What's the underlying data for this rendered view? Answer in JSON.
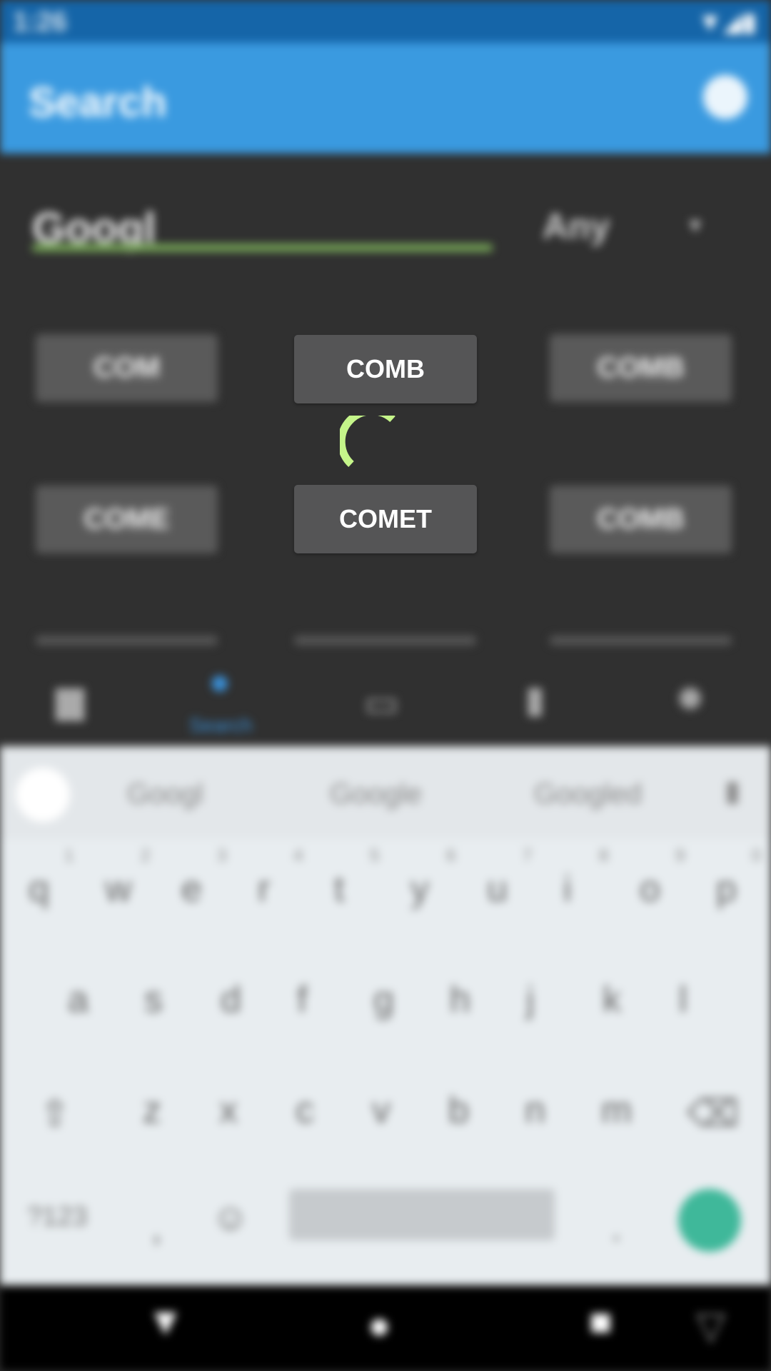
{
  "status_bar": {
    "time": "1:26"
  },
  "app_bar": {
    "title": "Search"
  },
  "search": {
    "query": "Googl",
    "type_label": "Any"
  },
  "results_blurred": [
    [
      "COM",
      "COMB",
      "COMB"
    ],
    [
      "COME",
      "COMET",
      "COMB"
    ]
  ],
  "overlay": {
    "button_1": "COMB",
    "button_2": "COMET",
    "spinner_color": "#c5f58a"
  },
  "bottom_nav": {
    "active_label": "Search"
  },
  "keyboard": {
    "suggestions": [
      "Googl",
      "Google",
      "Googled"
    ],
    "row1": [
      "q",
      "w",
      "e",
      "r",
      "t",
      "y",
      "u",
      "i",
      "o",
      "p"
    ],
    "row1_hints": [
      "1",
      "2",
      "3",
      "4",
      "5",
      "6",
      "7",
      "8",
      "9",
      "0"
    ],
    "row2": [
      "a",
      "s",
      "d",
      "f",
      "g",
      "h",
      "j",
      "k",
      "l"
    ],
    "row3": [
      "z",
      "x",
      "c",
      "v",
      "b",
      "n",
      "m"
    ],
    "symbols_key": "?123",
    "comma": ",",
    "period": "."
  }
}
